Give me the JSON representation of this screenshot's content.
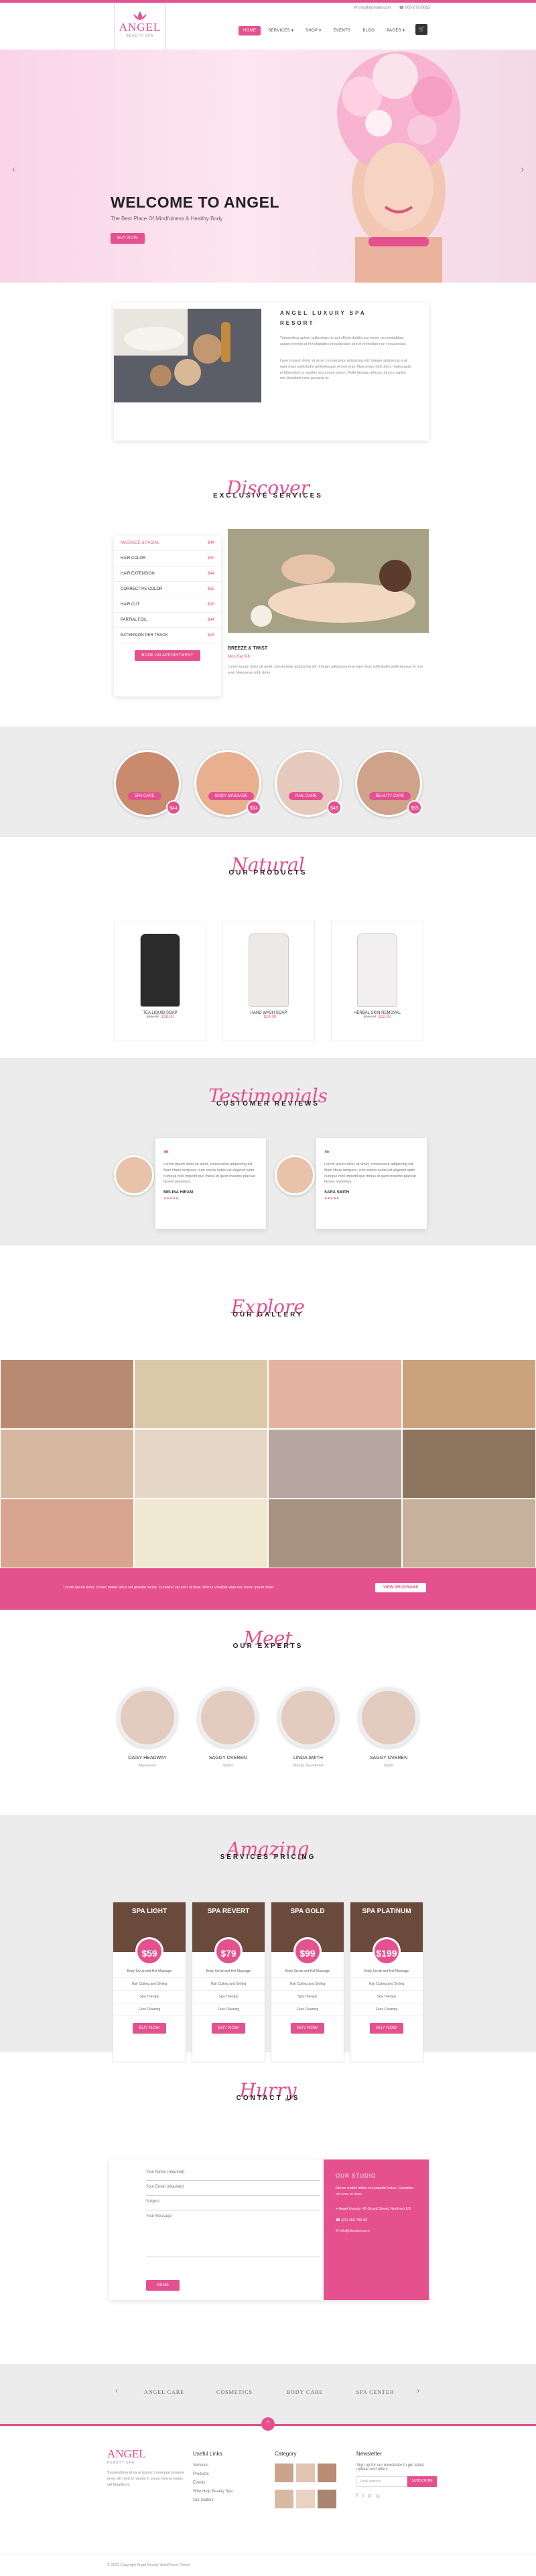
{
  "header": {
    "logo_name": "ANGEL",
    "logo_sub": "BEAUTY SPA",
    "email": "info@domain.com",
    "phone": "000-876-9865",
    "cart_count": "0",
    "nav": [
      {
        "label": "HOME",
        "active": true
      },
      {
        "label": "SERVICES ▾"
      },
      {
        "label": "SHOP ▾"
      },
      {
        "label": "EVENTS"
      },
      {
        "label": "BLOG"
      },
      {
        "label": "PAGES ▾"
      }
    ]
  },
  "hero": {
    "title": "WELCOME TO ANGEL",
    "subtitle": "The Best Place Of Mindfulness & Healthy Body",
    "button": "BUY NOW"
  },
  "about": {
    "title_line1": "ANGEL LUXURY SPA",
    "title_line2": "RESORT",
    "p1": "Temporibus autem quibusdam et aut officiis debitis aut rerum necessitatibus saepe eveniet ut et voluptates repudiandae sint et molestiae non recusandae.",
    "p2": "Lorem ipsum dolor sit amet, consectetur adipiscing elit. Integer adipiscing erat eget risus sollicitudin pellentesque et non erat. Maecenas nibh dolor, malesuada et bibendum a, sagittis accumsan ipsum. Pellentesque ultrices ultrices sapien, nec tincidunt nunc posuere ut."
  },
  "services": {
    "script": "Discover",
    "caps": "EXCLUSIVE SERVICES",
    "list": [
      {
        "name": "MASSAGE & FACIAL",
        "price": "$44",
        "highlight": true
      },
      {
        "name": "HAIR COLOR",
        "price": "$40"
      },
      {
        "name": "HAIR EXTENSION",
        "price": "$44"
      },
      {
        "name": "CORRECTIVE COLOR",
        "price": "$55"
      },
      {
        "name": "HAIR CUT",
        "price": "$28"
      },
      {
        "name": "PARTIAL FOIL",
        "price": "$44"
      },
      {
        "name": "EXTENSION PER TRACK",
        "price": "$34"
      }
    ],
    "appoint": "BOOK AN APPOINTMENT",
    "feature_title": "BREEZE & TWIST",
    "feature_sub": "Mon-Sat 9-6",
    "feature_text": "Lorem ipsum dolor sit amet, consectetur adipiscing elit. Integer adipiscing erat eget risus sollicitudin pellentesque et non erat. Maecenas nibh dolor."
  },
  "categories": [
    {
      "label": "SPA CARE",
      "price": "$44"
    },
    {
      "label": "BODY MASSAGE",
      "price": "$34"
    },
    {
      "label": "NAIL CARE",
      "price": "$45"
    },
    {
      "label": "BEAUTY CARE",
      "price": "$55"
    }
  ],
  "products": {
    "script": "Natural",
    "caps": "OUR PRODUCTS",
    "items": [
      {
        "name": "TEA LIQUID SOAP",
        "old": "$16.00",
        "price": "$18.00"
      },
      {
        "name": "HAND WASH SOAP",
        "old": "",
        "price": "$14.00"
      },
      {
        "name": "HERBAL SKIN REMOVAL",
        "old": "$16.00",
        "price": "$12.00"
      }
    ]
  },
  "testimonials": {
    "script": "Testimonials",
    "caps": "CUSTOMER REVIEWS",
    "items": [
      {
        "text": "Lorem ipsum dolor sit amet, consectetur adipiscing elit. Nam libero tempore, cum soluta nobis est eligendi optio cumque nihil impedit quo minus id quod maxime placeat facere possimus.",
        "name": "MELINA HIRAM"
      },
      {
        "text": "Lorem ipsum dolor sit amet, consectetur adipiscing elit. Nam libero tempore, cum soluta nobis est eligendi optio cumque nihil impedit quo minus id quod maxime placeat facere possimus.",
        "name": "SARA SMITH"
      }
    ]
  },
  "gallery": {
    "script": "Explore",
    "caps": "OUR GALLERY"
  },
  "promo": {
    "text": "Lorem ipsum dolor, Donec mattis tellus vel gravida luctus, Curabitur vel arcu ut risus ultrices volutpat vitae nec lorem ipsum dolor.",
    "button": "VIEW PROGRAMS"
  },
  "experts": {
    "script": "Meet",
    "caps": "OUR EXPERTS",
    "items": [
      {
        "name": "DAISY HEADWAY",
        "role": "Masseuse"
      },
      {
        "name": "SAGGY OVEREN",
        "role": "Stylist"
      },
      {
        "name": "LINDA SMITH",
        "role": "Beauty Ingredients"
      },
      {
        "name": "SAGGY OVEREN",
        "role": "Stylist"
      }
    ]
  },
  "pricing": {
    "script": "Amazing",
    "caps": "SERVICES PRICING",
    "plans": [
      {
        "name": "SPA LIGHT",
        "price": "$59"
      },
      {
        "name": "SPA REVERT",
        "price": "$79"
      },
      {
        "name": "SPA GOLD",
        "price": "$99"
      },
      {
        "name": "SPA PLATINUM",
        "price": "$199"
      }
    ],
    "features": [
      "Body Scrub and Hot Massage",
      "Hair Cutting and Styling",
      "Spa Therapy",
      "Face Cleaning"
    ],
    "button": "BUY NOW"
  },
  "contact": {
    "script": "Hurry",
    "caps": "CONTACT US",
    "fields": [
      "Your Name (required)",
      "Your Email (required)",
      "Subject",
      "Your Message"
    ],
    "send": "SEND",
    "studio_title": "OUR STUDIO",
    "studio_text": "Donec mattis tellus vel gravida luctus. Curabitur vel arcu ut risus.",
    "address": "Angel Beauty, 45 Grand Street, Northern US",
    "phone": "(01) 456 789 00",
    "email": "info@domain.com"
  },
  "brands": [
    "ANGEL CARE",
    "COSMETICS",
    "BODY CARE",
    "SPA CENTER"
  ],
  "footer": {
    "about": "Suspendisse id ex at ipsum consequat posuere ut eu elit. Sed id mauris in purus viverra varius vel fringilla ex.",
    "links_title": "Useful Links",
    "links": [
      "Services",
      "Products",
      "Events",
      "Who Help Beauty Spa",
      "Our Gallery"
    ],
    "cat_title": "Category",
    "news_title": "Newsletter",
    "news_text": "Sign up for our newsletter to get latest update and offers.",
    "news_placeholder": "Email address",
    "subscribe": "SUBSCRIBE",
    "copyright": "© 2023 Copyright Angel Beauty WordPress Theme"
  }
}
